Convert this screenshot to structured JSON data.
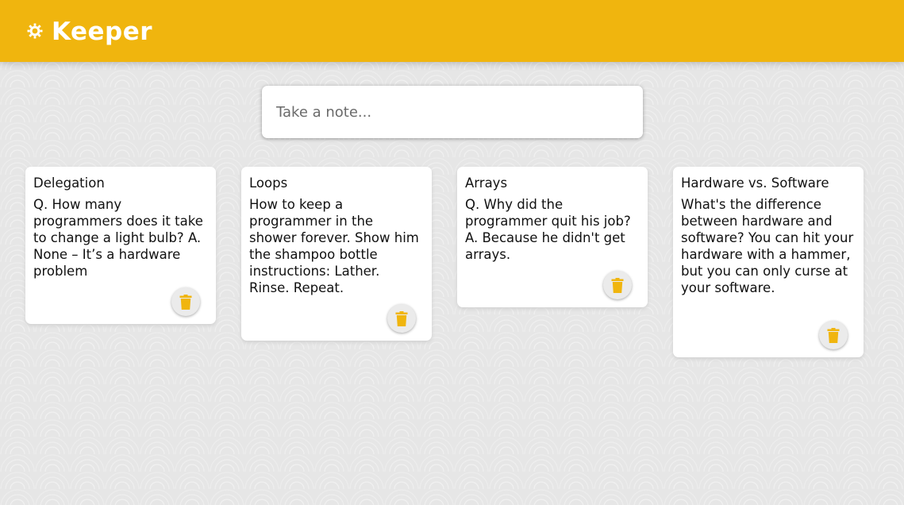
{
  "header": {
    "title": "Keeper",
    "logo_icon": "sun-icon",
    "brand_color": "#f0b50e"
  },
  "compose": {
    "placeholder": "Take a note..."
  },
  "notes": [
    {
      "title": "Delegation",
      "content": "Q. How many programmers does it take to change a light bulb? A. None – It’s a hardware problem",
      "delete_icon": "trash-icon"
    },
    {
      "title": "Loops",
      "content": "How to keep a programmer in the shower forever. Show him the shampoo bottle instructions: Lather. Rinse. Repeat.",
      "delete_icon": "trash-icon"
    },
    {
      "title": "Arrays",
      "content": "Q. Why did the programmer quit his job? A. Because he didn't get arrays.",
      "delete_icon": "trash-icon"
    },
    {
      "title": "Hardware vs. Software",
      "content": "What's the difference between hardware and software? You can hit your hardware with a hammer, but you can only curse at your software.",
      "delete_icon": "trash-icon"
    }
  ]
}
